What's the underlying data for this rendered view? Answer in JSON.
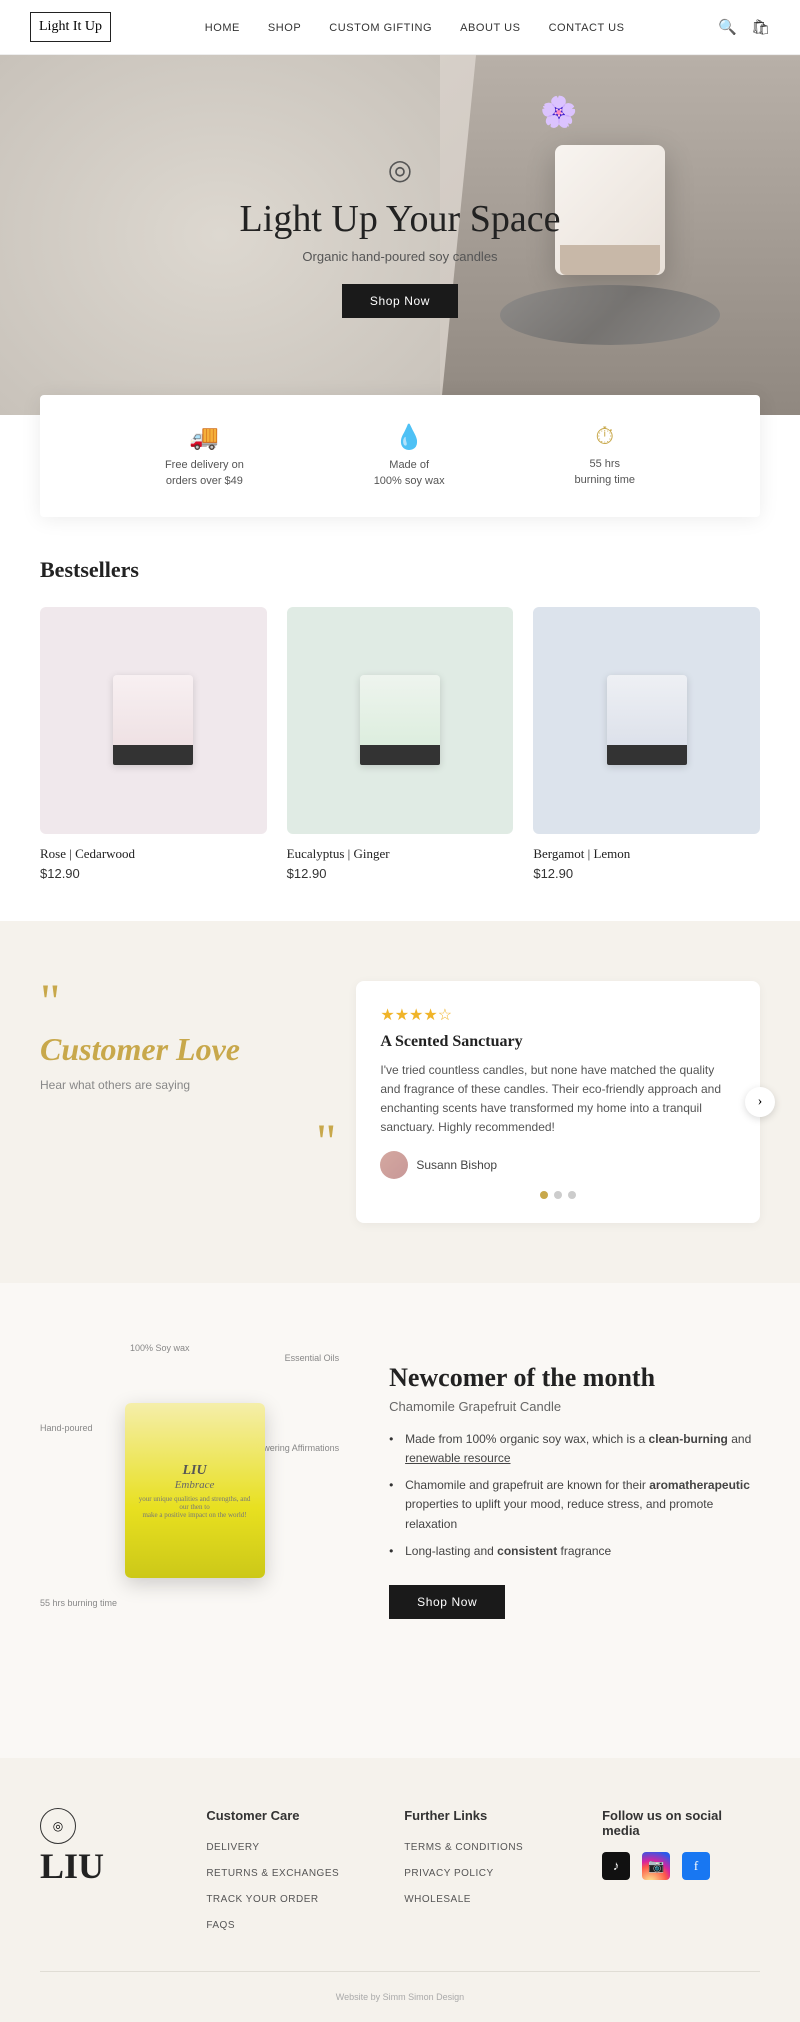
{
  "nav": {
    "logo": {
      "line1": "Light It",
      "line2": "Up"
    },
    "links": [
      "HOME",
      "SHOP",
      "CUSTOM GIFTING",
      "ABOUT US",
      "CONTACT US"
    ]
  },
  "hero": {
    "icon": "◎",
    "title": "Light Up Your Space",
    "subtitle": "Organic hand-poured soy candles",
    "cta": "Shop Now"
  },
  "features": [
    {
      "icon": "🚚",
      "text_line1": "Free delivery on",
      "text_line2": "orders over $49"
    },
    {
      "icon": "💧",
      "text_line1": "Made of",
      "text_line2": "100% soy wax"
    },
    {
      "icon": "⏱",
      "text_line1": "55 hrs",
      "text_line2": "burning time"
    }
  ],
  "bestsellers": {
    "title": "Bestsellers",
    "products": [
      {
        "name": "Rose | Cedarwood",
        "price": "$12.90",
        "color": "pink"
      },
      {
        "name": "Eucalyptus | Ginger",
        "price": "$12.90",
        "color": "green"
      },
      {
        "name": "Bergamot | Lemon",
        "price": "$12.90",
        "color": "blue"
      }
    ]
  },
  "customer_love": {
    "title": "Customer Love",
    "subtitle": "Hear what others are saying",
    "review": {
      "stars": 4,
      "title": "A Scented Sanctuary",
      "text": "I've tried countless candles, but none have matched the quality and fragrance of these candles. Their eco-friendly approach and enchanting scents have transformed my home into a tranquil sanctuary. Highly recommended!",
      "reviewer_name": "Susann Bishop",
      "dots": 3,
      "active_dot": 0
    }
  },
  "newcomer": {
    "badge": "",
    "title": "Newcomer of the month",
    "subtitle": "Chamomile Grapefruit Candle",
    "bullets": [
      {
        "text": "Made from 100% organic soy wax, which is a ",
        "bold": "clean-burning",
        "rest": " and ",
        "underline": "renewable resource"
      },
      {
        "text": "Chamomile and grapefruit are known for their ",
        "bold": "aromatherapeutic",
        "rest": " properties to uplift your mood, reduce stress, and promote relaxation"
      },
      {
        "text": "Long-lasting and ",
        "bold": "consistent",
        "rest": " fragrance"
      }
    ],
    "cta": "Shop Now",
    "annotations": [
      "100% Soy wax",
      "Essential Oils",
      "Hand-poured",
      "Empowering Affirmations",
      "55 hrs burning time"
    ]
  },
  "footer": {
    "logo_icon": "◎",
    "logo_text": "LIU",
    "customer_care": {
      "title": "Customer Care",
      "links": [
        "DELIVERY",
        "RETURNS & EXCHANGES",
        "TRACK YOUR ORDER",
        "FAQS"
      ]
    },
    "further_links": {
      "title": "Further Links",
      "links": [
        "TERMS & CONDITIONS",
        "PRIVACY POLICY",
        "WHOLESALE"
      ]
    },
    "social": {
      "title": "Follow us on social media",
      "icons": [
        "TikTok",
        "Instagram",
        "Facebook"
      ]
    },
    "credit": "Website by Simm Simon Design"
  }
}
